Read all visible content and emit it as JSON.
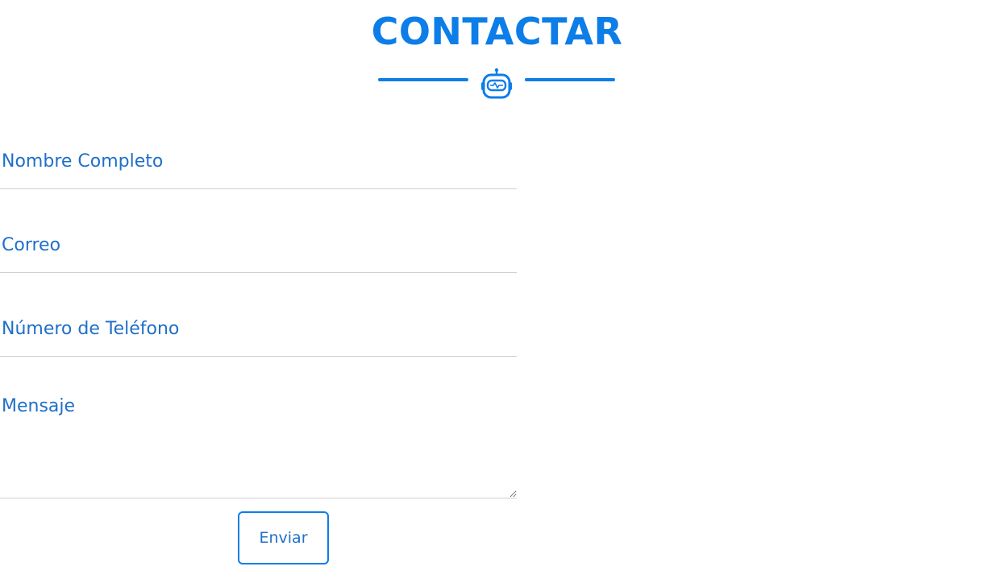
{
  "section": {
    "title": "CONTACTAR",
    "divider_icon": "robot-icon"
  },
  "form": {
    "name_placeholder": "Nombre Completo",
    "email_placeholder": "Correo",
    "phone_placeholder": "Número de Teléfono",
    "message_placeholder": "Mensaje",
    "submit_label": "Enviar"
  },
  "colors": {
    "accent": "#0d7de8",
    "placeholder_text": "#1f6fc9",
    "field_border": "#cfcfcf",
    "background": "#ffffff"
  }
}
